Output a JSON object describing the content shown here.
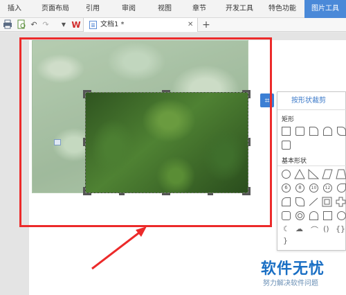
{
  "menu": {
    "tabs": [
      {
        "label": "插入",
        "active": false
      },
      {
        "label": "页面布局",
        "active": false
      },
      {
        "label": "引用",
        "active": false
      },
      {
        "label": "审阅",
        "active": false
      },
      {
        "label": "视图",
        "active": false
      },
      {
        "label": "章节",
        "active": false
      },
      {
        "label": "开发工具",
        "active": false
      },
      {
        "label": "特色功能",
        "active": false
      },
      {
        "label": "图片工具",
        "active": true
      }
    ]
  },
  "toolbar": {
    "icons": [
      "print-icon",
      "preview-icon",
      "undo-icon",
      "redo-icon",
      "dropdown-arrow-icon",
      "wps-logo-icon"
    ],
    "doc_tab": {
      "label": "文档1 *",
      "close": "✕"
    },
    "new_tab": "+"
  },
  "crop_panel": {
    "tab_label": "按形状裁剪",
    "sections": [
      {
        "title": "矩形"
      },
      {
        "title": "基本形状"
      }
    ]
  },
  "watermark": {
    "title": "软件无忧",
    "subtitle": "努力解决软件问题"
  },
  "colors": {
    "accent": "#4a89d8",
    "annotation": "#ec2a2a",
    "watermark": "#1a6fc4"
  }
}
